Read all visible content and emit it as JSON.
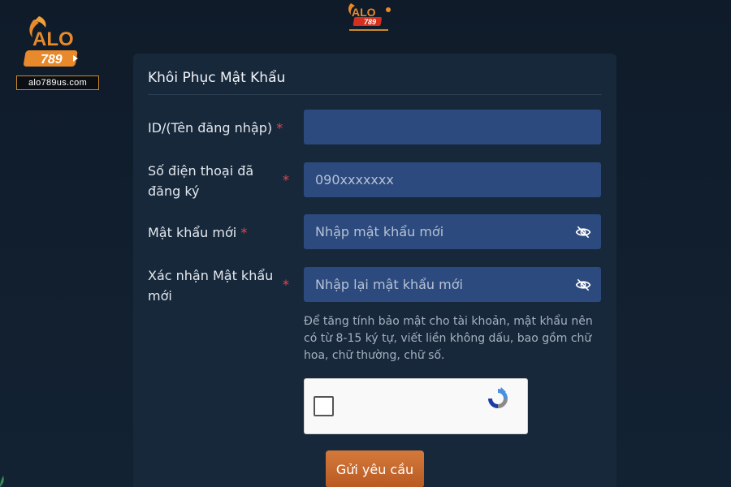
{
  "brand": {
    "site": "alo789us.com",
    "logo_word": "ALO",
    "logo_number": "789",
    "accent": "#e8892b",
    "secondary": "#d4301f"
  },
  "form": {
    "title": "Khôi Phục Mật Khẩu",
    "required_mark": "*",
    "fields": [
      {
        "label": "ID/(Tên đăng nhập)",
        "value": "",
        "placeholder": ""
      },
      {
        "label_line1": "Số điện thoại đã",
        "label_line2": "đăng ký",
        "value": "",
        "placeholder": "090xxxxxxx"
      },
      {
        "label": "Mật khẩu mới",
        "value": "",
        "placeholder": "Nhập mật khẩu mới",
        "icon": "eye-off-icon"
      },
      {
        "label_line1": "Xác nhận Mật khẩu",
        "label_line2": "mới",
        "value": "",
        "placeholder": "Nhập lại mật khẩu mới",
        "icon": "eye-off-icon"
      }
    ],
    "hint_lines": [
      "Để tăng tính bảo mật cho tài khoản, mật khẩu nên",
      "có từ 8-15 ký tự, viết liền không dấu, bao gồm chữ",
      "hoa, chữ thường, chữ số."
    ],
    "captcha_icon": "recaptcha-icon",
    "submit_label": "Gửi yêu cầu"
  },
  "colors": {
    "background": "#111d2b",
    "card": "#17283a",
    "input": "#2c4a7e",
    "required": "#e0484f",
    "button": "#c7672e"
  }
}
